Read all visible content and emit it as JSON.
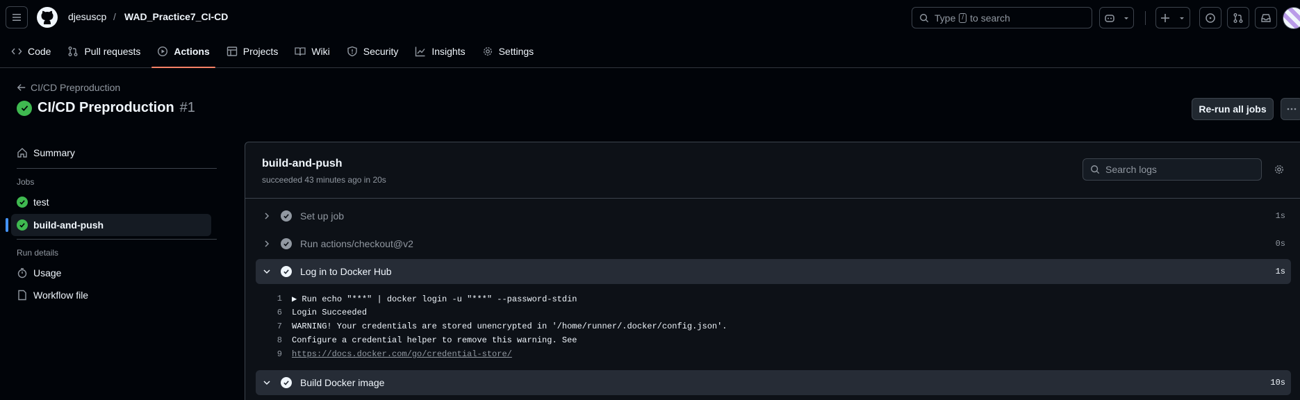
{
  "topbar": {
    "owner": "djesuscp",
    "separator": "/",
    "repo": "WAD_Practice7_CI-CD",
    "search_prefix": "Type",
    "search_key": "/",
    "search_suffix": "to search"
  },
  "tabs": [
    {
      "label": "Code",
      "icon": "code-icon"
    },
    {
      "label": "Pull requests",
      "icon": "pull-request-icon"
    },
    {
      "label": "Actions",
      "icon": "play-icon",
      "active": true
    },
    {
      "label": "Projects",
      "icon": "table-icon"
    },
    {
      "label": "Wiki",
      "icon": "book-icon"
    },
    {
      "label": "Security",
      "icon": "shield-icon"
    },
    {
      "label": "Insights",
      "icon": "graph-icon"
    },
    {
      "label": "Settings",
      "icon": "gear-icon"
    }
  ],
  "run": {
    "back_label": "CI/CD Preproduction",
    "title": "CI/CD Preproduction",
    "number": "#1",
    "rerun_label": "Re-run all jobs"
  },
  "sidebar": {
    "summary": "Summary",
    "jobs_heading": "Jobs",
    "jobs": [
      "test",
      "build-and-push"
    ],
    "details_heading": "Run details",
    "usage": "Usage",
    "workflow": "Workflow file"
  },
  "job": {
    "name": "build-and-push",
    "status": "succeeded 43 minutes ago in 20s",
    "search_placeholder": "Search logs",
    "steps": [
      {
        "label": "Set up job",
        "duration": "1s",
        "expanded": false
      },
      {
        "label": "Run actions/checkout@v2",
        "duration": "0s",
        "expanded": false
      },
      {
        "label": "Log in to Docker Hub",
        "duration": "1s",
        "expanded": true
      },
      {
        "label": "Build Docker image",
        "duration": "10s",
        "expanded": true
      }
    ],
    "log": [
      {
        "num": "1",
        "text": "▶ Run echo \"***\" | docker login -u \"***\" --password-stdin"
      },
      {
        "num": "6",
        "text": "Login Succeeded"
      },
      {
        "num": "7",
        "text": "WARNING! Your credentials are stored unencrypted in '/home/runner/.docker/config.json'."
      },
      {
        "num": "8",
        "text": "Configure a credential helper to remove this warning. See"
      },
      {
        "num": "9",
        "text": "https://docs.docker.com/go/credential-store/",
        "link": true
      }
    ]
  },
  "colors": {
    "success": "#3fb950",
    "accent": "#f78166",
    "selected_bar": "#4493f8"
  }
}
